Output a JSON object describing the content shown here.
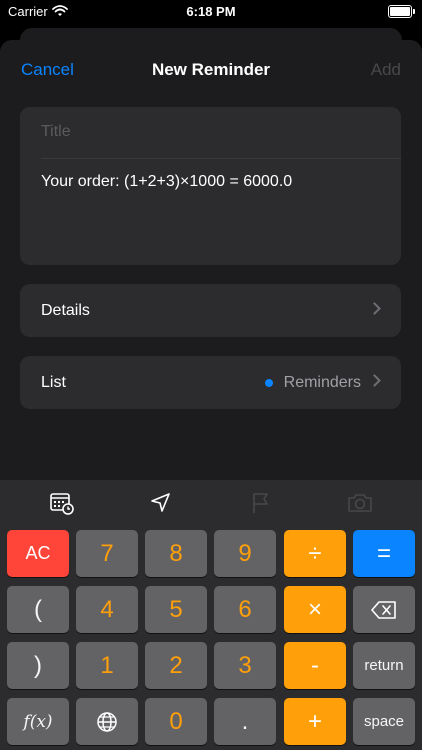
{
  "status": {
    "carrier": "Carrier",
    "time": "6:18 PM"
  },
  "nav": {
    "cancel": "Cancel",
    "title": "New Reminder",
    "add": "Add"
  },
  "form": {
    "title_placeholder": "Title",
    "notes": "Your order: (1+2+3)×1000 = 6000.0",
    "details_label": "Details",
    "list_label": "List",
    "list_value": "Reminders"
  },
  "toolbar": {
    "icons": [
      "calendar-clock-icon",
      "location-arrow-icon",
      "flag-icon",
      "camera-icon"
    ]
  },
  "keys": {
    "row1": [
      "AC",
      "7",
      "8",
      "9",
      "÷",
      "="
    ],
    "row2": [
      "(",
      "4",
      "5",
      "6",
      "×",
      "backspace"
    ],
    "row3": [
      ")",
      "1",
      "2",
      "3",
      "-",
      "return"
    ],
    "row4": [
      "f(x)",
      "globe",
      "0",
      ".",
      "+",
      "space"
    ]
  },
  "colors": {
    "accent": "#0a84ff",
    "operator": "#ff9f0a",
    "clear": "#ff453a",
    "background": "#1c1c1e"
  }
}
